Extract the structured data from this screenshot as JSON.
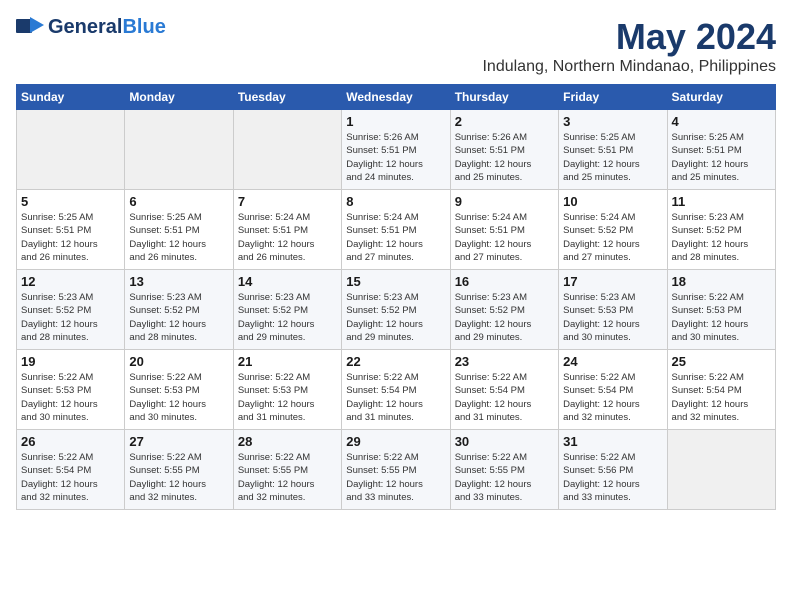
{
  "header": {
    "logo_general": "General",
    "logo_blue": "Blue",
    "title": "May 2024",
    "subtitle": "Indulang, Northern Mindanao, Philippines"
  },
  "days_of_week": [
    "Sunday",
    "Monday",
    "Tuesday",
    "Wednesday",
    "Thursday",
    "Friday",
    "Saturday"
  ],
  "weeks": [
    [
      {
        "day": "",
        "info": ""
      },
      {
        "day": "",
        "info": ""
      },
      {
        "day": "",
        "info": ""
      },
      {
        "day": "1",
        "info": "Sunrise: 5:26 AM\nSunset: 5:51 PM\nDaylight: 12 hours\nand 24 minutes."
      },
      {
        "day": "2",
        "info": "Sunrise: 5:26 AM\nSunset: 5:51 PM\nDaylight: 12 hours\nand 25 minutes."
      },
      {
        "day": "3",
        "info": "Sunrise: 5:25 AM\nSunset: 5:51 PM\nDaylight: 12 hours\nand 25 minutes."
      },
      {
        "day": "4",
        "info": "Sunrise: 5:25 AM\nSunset: 5:51 PM\nDaylight: 12 hours\nand 25 minutes."
      }
    ],
    [
      {
        "day": "5",
        "info": "Sunrise: 5:25 AM\nSunset: 5:51 PM\nDaylight: 12 hours\nand 26 minutes."
      },
      {
        "day": "6",
        "info": "Sunrise: 5:25 AM\nSunset: 5:51 PM\nDaylight: 12 hours\nand 26 minutes."
      },
      {
        "day": "7",
        "info": "Sunrise: 5:24 AM\nSunset: 5:51 PM\nDaylight: 12 hours\nand 26 minutes."
      },
      {
        "day": "8",
        "info": "Sunrise: 5:24 AM\nSunset: 5:51 PM\nDaylight: 12 hours\nand 27 minutes."
      },
      {
        "day": "9",
        "info": "Sunrise: 5:24 AM\nSunset: 5:51 PM\nDaylight: 12 hours\nand 27 minutes."
      },
      {
        "day": "10",
        "info": "Sunrise: 5:24 AM\nSunset: 5:52 PM\nDaylight: 12 hours\nand 27 minutes."
      },
      {
        "day": "11",
        "info": "Sunrise: 5:23 AM\nSunset: 5:52 PM\nDaylight: 12 hours\nand 28 minutes."
      }
    ],
    [
      {
        "day": "12",
        "info": "Sunrise: 5:23 AM\nSunset: 5:52 PM\nDaylight: 12 hours\nand 28 minutes."
      },
      {
        "day": "13",
        "info": "Sunrise: 5:23 AM\nSunset: 5:52 PM\nDaylight: 12 hours\nand 28 minutes."
      },
      {
        "day": "14",
        "info": "Sunrise: 5:23 AM\nSunset: 5:52 PM\nDaylight: 12 hours\nand 29 minutes."
      },
      {
        "day": "15",
        "info": "Sunrise: 5:23 AM\nSunset: 5:52 PM\nDaylight: 12 hours\nand 29 minutes."
      },
      {
        "day": "16",
        "info": "Sunrise: 5:23 AM\nSunset: 5:52 PM\nDaylight: 12 hours\nand 29 minutes."
      },
      {
        "day": "17",
        "info": "Sunrise: 5:23 AM\nSunset: 5:53 PM\nDaylight: 12 hours\nand 30 minutes."
      },
      {
        "day": "18",
        "info": "Sunrise: 5:22 AM\nSunset: 5:53 PM\nDaylight: 12 hours\nand 30 minutes."
      }
    ],
    [
      {
        "day": "19",
        "info": "Sunrise: 5:22 AM\nSunset: 5:53 PM\nDaylight: 12 hours\nand 30 minutes."
      },
      {
        "day": "20",
        "info": "Sunrise: 5:22 AM\nSunset: 5:53 PM\nDaylight: 12 hours\nand 30 minutes."
      },
      {
        "day": "21",
        "info": "Sunrise: 5:22 AM\nSunset: 5:53 PM\nDaylight: 12 hours\nand 31 minutes."
      },
      {
        "day": "22",
        "info": "Sunrise: 5:22 AM\nSunset: 5:54 PM\nDaylight: 12 hours\nand 31 minutes."
      },
      {
        "day": "23",
        "info": "Sunrise: 5:22 AM\nSunset: 5:54 PM\nDaylight: 12 hours\nand 31 minutes."
      },
      {
        "day": "24",
        "info": "Sunrise: 5:22 AM\nSunset: 5:54 PM\nDaylight: 12 hours\nand 32 minutes."
      },
      {
        "day": "25",
        "info": "Sunrise: 5:22 AM\nSunset: 5:54 PM\nDaylight: 12 hours\nand 32 minutes."
      }
    ],
    [
      {
        "day": "26",
        "info": "Sunrise: 5:22 AM\nSunset: 5:54 PM\nDaylight: 12 hours\nand 32 minutes."
      },
      {
        "day": "27",
        "info": "Sunrise: 5:22 AM\nSunset: 5:55 PM\nDaylight: 12 hours\nand 32 minutes."
      },
      {
        "day": "28",
        "info": "Sunrise: 5:22 AM\nSunset: 5:55 PM\nDaylight: 12 hours\nand 32 minutes."
      },
      {
        "day": "29",
        "info": "Sunrise: 5:22 AM\nSunset: 5:55 PM\nDaylight: 12 hours\nand 33 minutes."
      },
      {
        "day": "30",
        "info": "Sunrise: 5:22 AM\nSunset: 5:55 PM\nDaylight: 12 hours\nand 33 minutes."
      },
      {
        "day": "31",
        "info": "Sunrise: 5:22 AM\nSunset: 5:56 PM\nDaylight: 12 hours\nand 33 minutes."
      },
      {
        "day": "",
        "info": ""
      }
    ]
  ]
}
